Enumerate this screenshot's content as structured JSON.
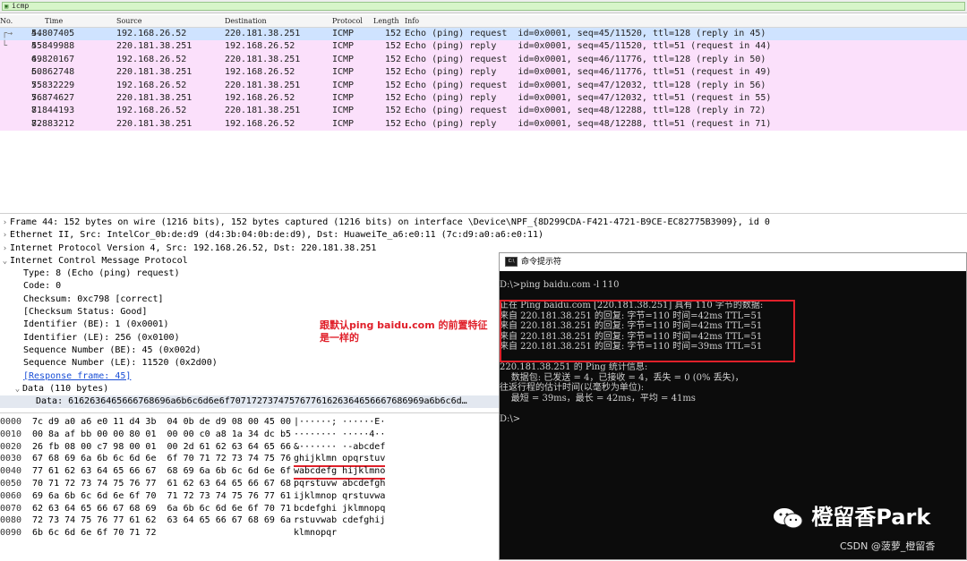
{
  "filter": {
    "value": "icmp"
  },
  "packet_list": {
    "columns": [
      "No.",
      "Time",
      "Source",
      "Destination",
      "Protocol",
      "Length",
      "Info"
    ],
    "rows": [
      {
        "no": "44",
        "time": "5.807405",
        "src": "192.168.26.52",
        "dst": "220.181.38.251",
        "proto": "ICMP",
        "len": "152",
        "info": "Echo (ping) request  id=0x0001, seq=45/11520, ttl=128 (reply in 45)"
      },
      {
        "no": "45",
        "time": "5.849988",
        "src": "220.181.38.251",
        "dst": "192.168.26.52",
        "proto": "ICMP",
        "len": "152",
        "info": "Echo (ping) reply    id=0x0001, seq=45/11520, ttl=51 (request in 44)"
      },
      {
        "no": "49",
        "time": "6.820167",
        "src": "192.168.26.52",
        "dst": "220.181.38.251",
        "proto": "ICMP",
        "len": "152",
        "info": "Echo (ping) request  id=0x0001, seq=46/11776, ttl=128 (reply in 50)"
      },
      {
        "no": "50",
        "time": "6.862748",
        "src": "220.181.38.251",
        "dst": "192.168.26.52",
        "proto": "ICMP",
        "len": "152",
        "info": "Echo (ping) reply    id=0x0001, seq=46/11776, ttl=51 (request in 49)"
      },
      {
        "no": "55",
        "time": "7.832229",
        "src": "192.168.26.52",
        "dst": "220.181.38.251",
        "proto": "ICMP",
        "len": "152",
        "info": "Echo (ping) request  id=0x0001, seq=47/12032, ttl=128 (reply in 56)"
      },
      {
        "no": "56",
        "time": "7.874627",
        "src": "220.181.38.251",
        "dst": "192.168.26.52",
        "proto": "ICMP",
        "len": "152",
        "info": "Echo (ping) reply    id=0x0001, seq=47/12032, ttl=51 (request in 55)"
      },
      {
        "no": "71",
        "time": "8.844193",
        "src": "192.168.26.52",
        "dst": "220.181.38.251",
        "proto": "ICMP",
        "len": "152",
        "info": "Echo (ping) request  id=0x0001, seq=48/12288, ttl=128 (reply in 72)"
      },
      {
        "no": "72",
        "time": "8.883212",
        "src": "220.181.38.251",
        "dst": "192.168.26.52",
        "proto": "ICMP",
        "len": "152",
        "info": "Echo (ping) reply    id=0x0001, seq=48/12288, ttl=51 (request in 71)"
      }
    ]
  },
  "details_top": [
    "Frame 44: 152 bytes on wire (1216 bits), 152 bytes captured (1216 bits) on interface \\Device\\NPF_{8D299CDA-F421-4721-B9CE-EC82775B3909}, id 0",
    "Ethernet II, Src: IntelCor_0b:de:d9 (d4:3b:04:0b:de:d9), Dst: HuaweiTe_a6:e0:11 (7c:d9:a0:a6:e0:11)",
    "Internet Protocol Version 4, Src: 192.168.26.52, Dst: 220.181.38.251"
  ],
  "details_icmp": {
    "header": "Internet Control Message Protocol",
    "fields": [
      "Type: 8 (Echo (ping) request)",
      "Code: 0",
      "Checksum: 0xc798 [correct]",
      "[Checksum Status: Good]",
      "Identifier (BE): 1 (0x0001)",
      "Identifier (LE): 256 (0x0100)",
      "Sequence Number (BE): 45 (0x002d)",
      "Sequence Number (LE): 11520 (0x2d00)"
    ],
    "response_link": "[Response frame: 45]",
    "data_header": "Data (110 bytes)",
    "data_value": "Data: 6162636465666768696a6b6c6d6e6f707172737475767761626364656667686969a6b6c6d…"
  },
  "hex_dump": [
    {
      "off": "0000",
      "hex": "7c d9 a0 a6 e0 11 d4 3b  04 0b de d9 08 00 45 00",
      "ascii": "|······; ······E·"
    },
    {
      "off": "0010",
      "hex": "00 8a af bb 00 00 80 01  00 00 c0 a8 1a 34 dc b5",
      "ascii": "········ ·····4··"
    },
    {
      "off": "0020",
      "hex": "26 fb 08 00 c7 98 00 01  00 2d 61 62 63 64 65 66",
      "ascii": "&······· ·-abcdef"
    },
    {
      "off": "0030",
      "hex": "67 68 69 6a 6b 6c 6d 6e  6f 70 71 72 73 74 75 76",
      "ascii": "ghijklmn opqrstuv"
    },
    {
      "off": "0040",
      "hex": "77 61 62 63 64 65 66 67  68 69 6a 6b 6c 6d 6e 6f",
      "ascii": "wabcdefg hijklmno"
    },
    {
      "off": "0050",
      "hex": "70 71 72 73 74 75 76 77  61 62 63 64 65 66 67 68",
      "ascii": "pqrstuvw abcdefgh"
    },
    {
      "off": "0060",
      "hex": "69 6a 6b 6c 6d 6e 6f 70  71 72 73 74 75 76 77 61",
      "ascii": "ijklmnop qrstuvwa"
    },
    {
      "off": "0070",
      "hex": "62 63 64 65 66 67 68 69  6a 6b 6c 6d 6e 6f 70 71",
      "ascii": "bcdefghi jklmnopq"
    },
    {
      "off": "0080",
      "hex": "72 73 74 75 76 77 61 62  63 64 65 66 67 68 69 6a",
      "ascii": "rstuvwab cdefghij"
    },
    {
      "off": "0090",
      "hex": "6b 6c 6d 6e 6f 70 71 72",
      "ascii": "klmnopqr"
    }
  ],
  "annotation": "跟默认ping baidu.com 的前置特征是一样的",
  "cmd": {
    "title": "命令提示符",
    "icon_text": "C:\\",
    "lines": [
      "D:\\>ping baidu.com -l 110",
      "",
      "正在 Ping baidu.com [220.181.38.251] 具有 110 字节的数据:",
      "来自 220.181.38.251 的回复: 字节=110 时间=42ms TTL=51",
      "来自 220.181.38.251 的回复: 字节=110 时间=42ms TTL=51",
      "来自 220.181.38.251 的回复: 字节=110 时间=42ms TTL=51",
      "来自 220.181.38.251 的回复: 字节=110 时间=39ms TTL=51",
      "",
      "220.181.38.251 的 Ping 统计信息:",
      "    数据包: 已发送 = 4，已接收 = 4，丢失 = 0 (0% 丢失)，",
      "往返行程的估计时间(以毫秒为单位):",
      "    最短 = 39ms，最长 = 42ms，平均 = 41ms",
      "",
      "D:\\>"
    ]
  },
  "watermark": "橙留香Park",
  "credit": "CSDN @菠萝_橙留香",
  "colors": {
    "row_bg": "#fbe0fb",
    "selected_bg": "#cfe3ff",
    "accent_red": "#e0202a",
    "cmd_bg": "#0c0c0c"
  }
}
